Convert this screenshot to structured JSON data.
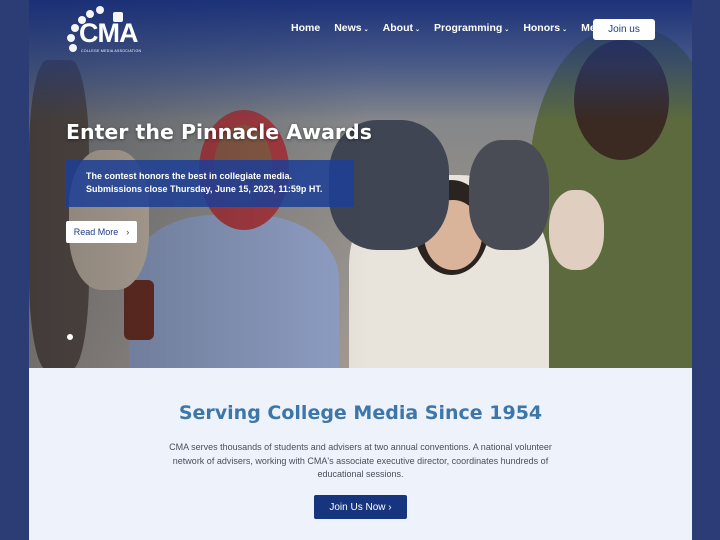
{
  "logo": {
    "wordmark": "CMA",
    "tagline": "COLLEGE MEDIA ASSOCIATION"
  },
  "nav": {
    "items": [
      {
        "label": "Home",
        "has_dropdown": false
      },
      {
        "label": "News",
        "has_dropdown": true
      },
      {
        "label": "About",
        "has_dropdown": true
      },
      {
        "label": "Programming",
        "has_dropdown": true
      },
      {
        "label": "Honors",
        "has_dropdown": true
      },
      {
        "label": "Members",
        "has_dropdown": true
      }
    ],
    "cta_label": "Join us"
  },
  "hero": {
    "title": "Enter the Pinnacle Awards",
    "description": "The contest honors the best in collegiate media. Submissions close Thursday, June 15, 2023, 11:59p HT.",
    "button_label": "Read More",
    "button_icon": "chevron-right-icon"
  },
  "intro": {
    "title": "Serving College Media Since 1954",
    "text": "CMA serves thousands of students and advisers at two annual conventions. A national volunteer network of advisers, working with CMA's associate executive director, coordinates hundreds of educational sessions.",
    "button_label": "Join Us Now ›"
  },
  "colors": {
    "brand_blue": "#17357e",
    "heading_blue": "#3d76a8",
    "page_bg": "#eef2fa"
  }
}
